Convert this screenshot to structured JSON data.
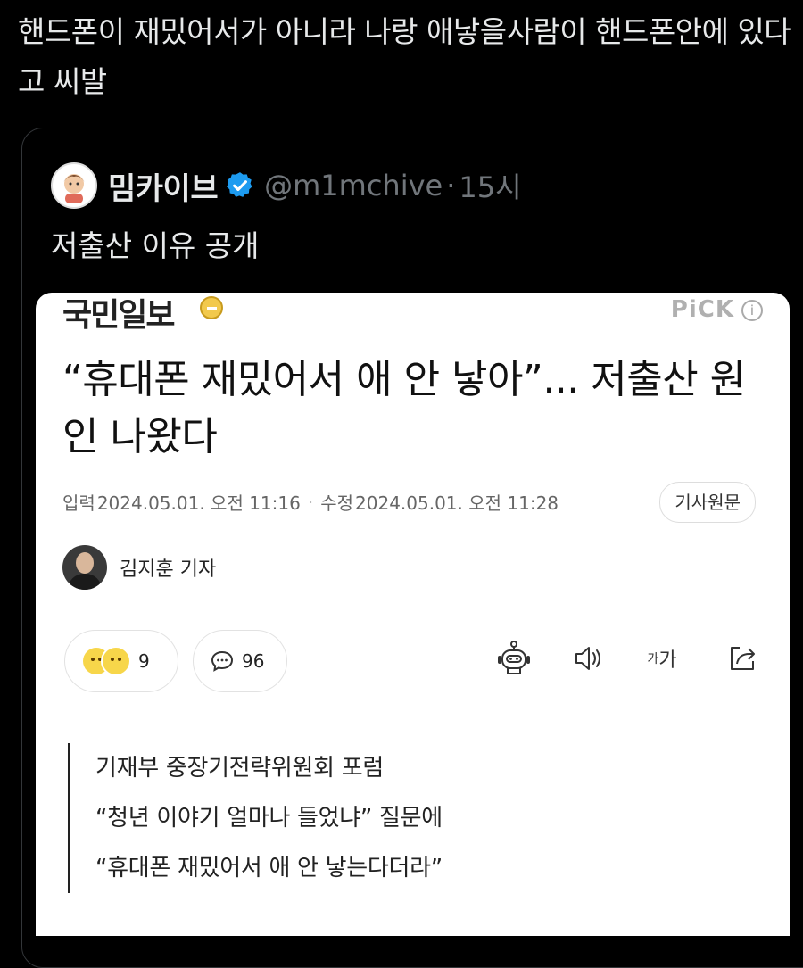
{
  "tweet": {
    "text": "핸드폰이 재밌어서가 아니라 나랑 애낳을사람이 핸드폰안에 있다고 씨발"
  },
  "quote": {
    "display_name": "밈카이브",
    "handle": "@m1mchive",
    "separator": "·",
    "time": "15시",
    "text": "저출산 이유 공개"
  },
  "article": {
    "press": "국민일보",
    "pick_label": "PiCK",
    "info_symbol": "i",
    "headline": "“휴대폰 재밌어서 애 안 낳아”... 저출산 원인 나왔다",
    "input_label": "입력",
    "input_time": "2024.05.01. 오전 11:16",
    "updated_label": "수정",
    "updated_time": "2024.05.01. 오전 11:28",
    "original_button": "기사원문",
    "reporter": "김지훈 기자",
    "reaction_count": "9",
    "comment_count": "96",
    "font_tool_label_small": "가",
    "font_tool_label": "가",
    "summary": [
      "기재부 중장기전략위원회 포럼",
      "“청년 이야기 얼마나 들었냐” 질문에",
      "“휴대폰 재밌어서 애 안 낳는다더라”"
    ]
  },
  "icons": {
    "verified": "verified-badge-icon",
    "robot": "robot-icon",
    "speaker": "speaker-icon",
    "share": "share-icon",
    "comment": "comment-bubble-icon"
  },
  "colors": {
    "background": "#000000",
    "text_primary": "#e7e9ea",
    "text_secondary": "#71767b",
    "verified_blue": "#1d9bf0",
    "article_bg": "#ffffff"
  }
}
